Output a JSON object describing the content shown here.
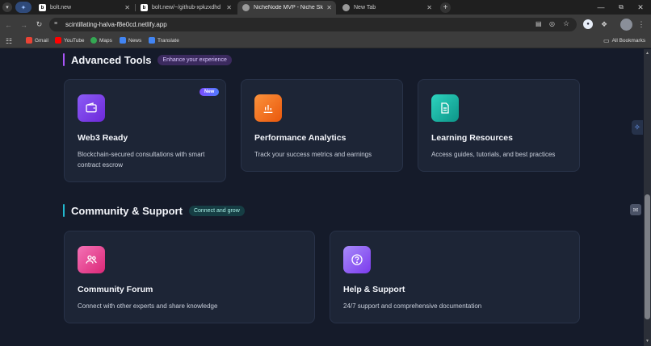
{
  "browser": {
    "tabs": [
      {
        "label": "bolt.new",
        "favicon": "b"
      },
      {
        "label": "bolt.new/~/github-xpkzxdhd",
        "favicon": "b"
      },
      {
        "label": "NicheNode MVP - Niche Skills",
        "favicon": "globe"
      },
      {
        "label": "New Tab",
        "favicon": "globe"
      }
    ],
    "url": "scintillating-halva-f8e0cd.netlify.app",
    "bookmarks": [
      "Gmail",
      "YouTube",
      "Maps",
      "News",
      "Translate"
    ],
    "all_bookmarks": "All Bookmarks"
  },
  "advanced_tools": {
    "title": "Advanced Tools",
    "pill": "Enhance your experience",
    "cards": [
      {
        "title": "Web3 Ready",
        "desc_line1": "Blockchain-secured consultations with smart",
        "desc_line2": "contract escrow",
        "badge": "New",
        "icon": "wallet-icon"
      },
      {
        "title": "Performance Analytics",
        "desc_line1": "Track your success metrics and earnings",
        "icon": "bar-chart-icon"
      },
      {
        "title": "Learning Resources",
        "desc_line1": "Access guides, tutorials, and best practices",
        "icon": "document-icon"
      }
    ]
  },
  "community": {
    "title": "Community & Support",
    "pill": "Connect and grow",
    "cards": [
      {
        "title": "Community Forum",
        "desc": "Connect with other experts and share knowledge",
        "icon": "users-icon"
      },
      {
        "title": "Help & Support",
        "desc": "24/7 support and comprehensive documentation",
        "icon": "help-icon"
      }
    ]
  },
  "colors": {
    "advanced_accent": "#a855f7",
    "community_accent": "#22b8cf",
    "web3_icon": "#7c3aed",
    "analytics_icon": "#f97316",
    "learning_icon": "#14b8a6",
    "forum_icon": "#ec4899",
    "help_icon": "#8b5cf6"
  }
}
